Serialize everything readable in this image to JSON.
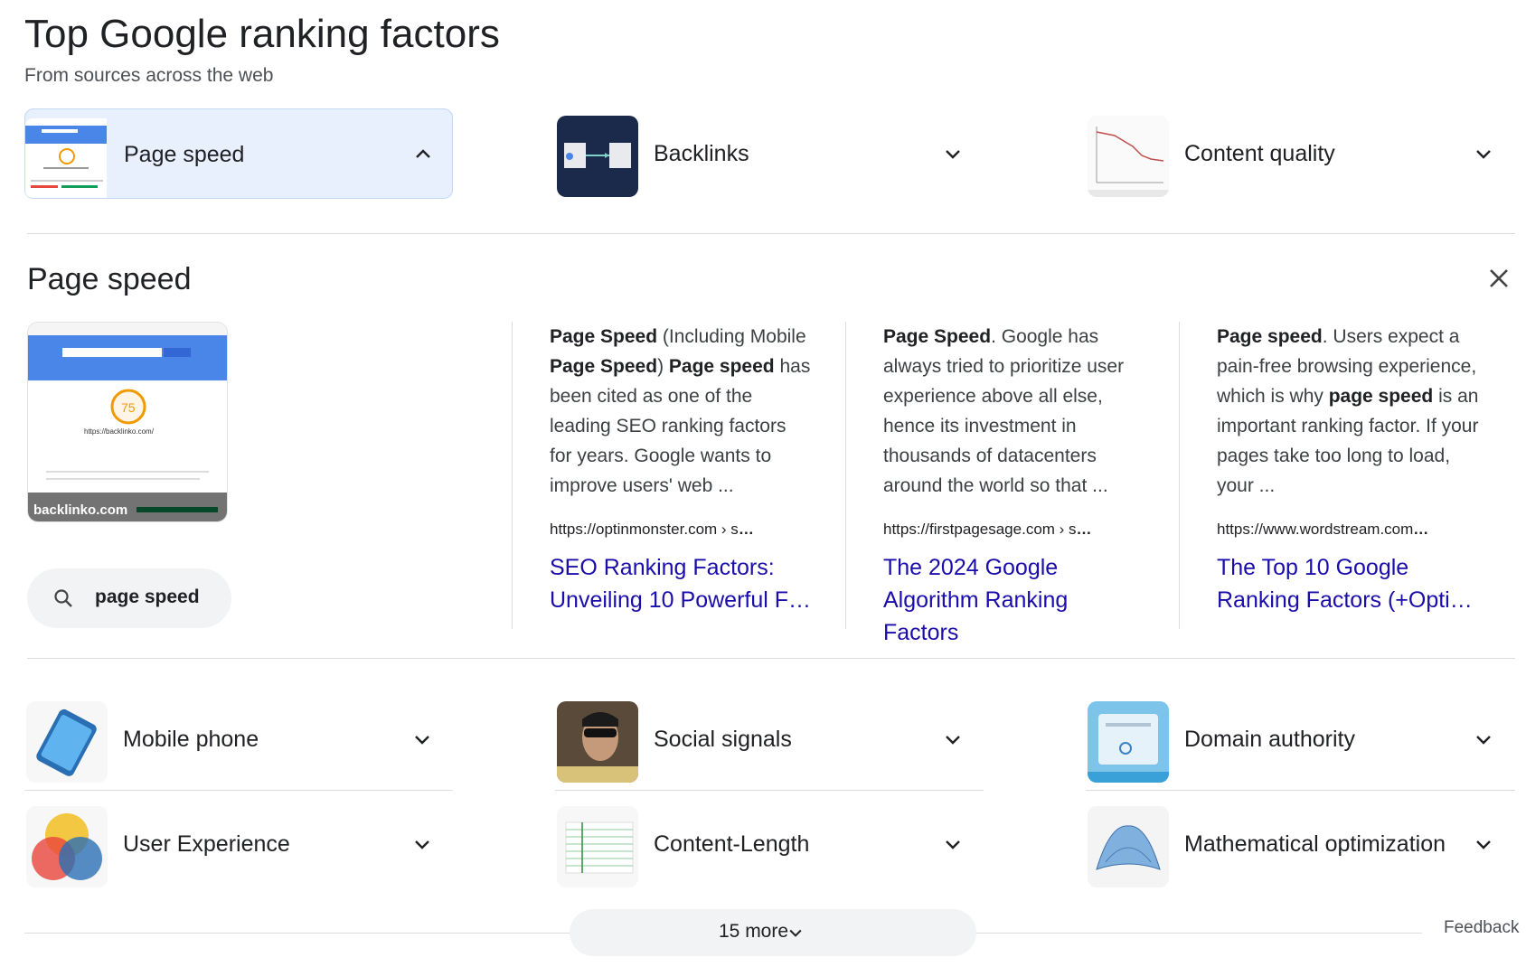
{
  "header": {
    "title": "Top Google ranking factors",
    "subtitle": "From sources across the web"
  },
  "chips_top": [
    {
      "label": "Page speed",
      "icon": "page-speed-thumbnail",
      "expanded": true
    },
    {
      "label": "Backlinks",
      "icon": "backlinks-thumbnail",
      "expanded": false
    },
    {
      "label": "Content quality",
      "icon": "content-quality-chart-thumbnail",
      "expanded": false
    }
  ],
  "panel": {
    "title": "Page speed",
    "image_caption": "backlinko.com",
    "image_url_text": "https://backlinko.com/",
    "image_score": "75",
    "query": "page speed",
    "sources": [
      {
        "snippet_html": "<b>Page Speed</b> (Including Mobile <b>Page Speed</b>) <b>Page speed</b> has been cited as one of the leading SEO ranking factors for years. Google wants to improve users' web ...",
        "cite": "https://optinmonster.com › s",
        "link": "SEO Ranking Factors: Unveiling 10 Powerful F…"
      },
      {
        "snippet_html": "<b>Page Speed</b>. Google has always tried to prioritize user experience above all else, hence its investment in thousands of datacenters around the world so that ...",
        "cite": "https://firstpagesage.com › s",
        "link": "The 2024 Google Algorithm Ranking Factors"
      },
      {
        "snippet_html": "<b>Page speed</b>. Users expect a pain-free browsing experience, which is why <b>page speed</b> is an important ranking factor. If your pages take too long to load, your ...",
        "cite": "https://www.wordstream.com",
        "link": "The Top 10 Google Ranking Factors (+Opti…"
      }
    ]
  },
  "chips_bottom": [
    {
      "label": "Mobile phone",
      "icon": "mobile-phone-thumbnail"
    },
    {
      "label": "Social signals",
      "icon": "social-signals-photo-thumbnail"
    },
    {
      "label": "Domain authority",
      "icon": "domain-authority-thumbnail"
    },
    {
      "label": "User Experience",
      "icon": "venn-diagram-thumbnail"
    },
    {
      "label": "Content-Length",
      "icon": "content-length-chart-thumbnail"
    },
    {
      "label": "Mathematical optimization",
      "icon": "3d-surface-plot-thumbnail"
    }
  ],
  "footer": {
    "more_label": "15 more",
    "feedback": "Feedback"
  },
  "colors": {
    "link": "#1a0dab",
    "active_chip": "#e8f0fe",
    "psi_blue": "#4285f4"
  }
}
